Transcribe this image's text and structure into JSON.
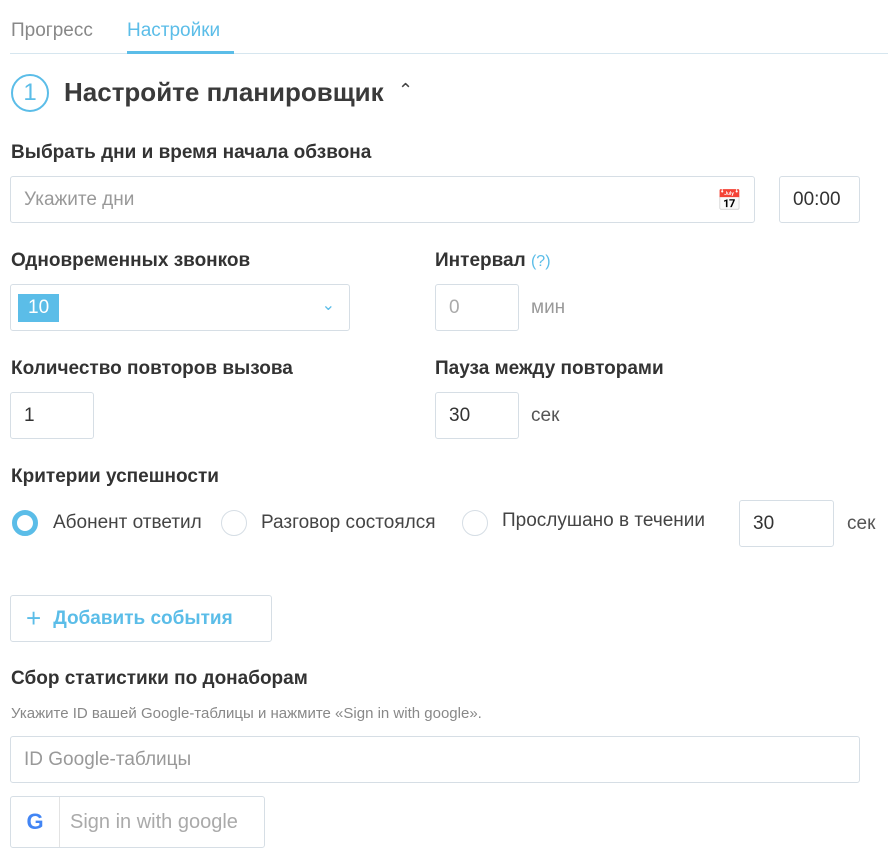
{
  "tabs": [
    {
      "label": "Прогресс",
      "active": false
    },
    {
      "label": "Настройки",
      "active": true
    }
  ],
  "section": {
    "number": "1",
    "title": "Настройте планировщик"
  },
  "days": {
    "label": "Выбрать дни и время начала обзвона",
    "placeholder": "Укажите дни",
    "time": "00:00"
  },
  "concurrent": {
    "label": "Одновременных звонков",
    "value": "10"
  },
  "interval": {
    "label": "Интервал",
    "help": "(?)",
    "value": "0",
    "unit": "мин"
  },
  "retries": {
    "label": "Количество повторов вызова",
    "value": "1"
  },
  "pause": {
    "label": "Пауза между повторами",
    "value": "30",
    "unit": "сек"
  },
  "criteria": {
    "label": "Критерии успешности",
    "options": [
      {
        "label": "Абонент ответил",
        "selected": true
      },
      {
        "label": "Разговор состоялся",
        "selected": false
      },
      {
        "label": "Прослушано в течении",
        "selected": false
      }
    ],
    "listen_value": "30",
    "listen_unit": "сек"
  },
  "add_events": {
    "label": "Добавить события"
  },
  "stats": {
    "label": "Сбор статистики по донаборам",
    "hint": "Укажите ID вашей Google-таблицы и нажмите «Sign in with google».",
    "placeholder": "ID Google-таблицы",
    "signin": "Sign in with google"
  },
  "colors": {
    "accent": "#5bbde8"
  }
}
